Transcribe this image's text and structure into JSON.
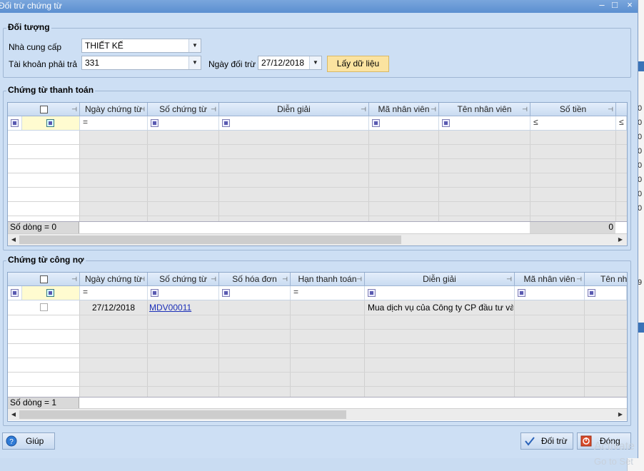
{
  "window": {
    "title": "Đối trừ chứng từ",
    "minimize": "–",
    "maximize": "□",
    "close": "×"
  },
  "doi_tuong": {
    "legend": "Đối tượng",
    "supplier_label": "Nhà cung cấp",
    "supplier_value": "THIẾT KẾ",
    "account_label": "Tài khoản phải trả",
    "account_value": "331",
    "date_label": "Ngày đối trừ",
    "date_value": "27/12/2018",
    "fetch_button": "Lấy dữ liệu"
  },
  "payment_grid": {
    "legend": "Chứng từ thanh toán",
    "columns": [
      "Ngày chứng từ",
      "Số chứng từ",
      "Diễn giải",
      "Mã nhân viên",
      "Tên nhân viên",
      "Số tiền"
    ],
    "filter_ops": {
      "date": "=",
      "amount": "≤",
      "amount2": "≤"
    },
    "row_count_label": "Số dòng = 0",
    "total": "0"
  },
  "debt_grid": {
    "legend": "Chứng từ công nợ",
    "columns": [
      "Ngày chứng từ",
      "Số chứng từ",
      "Số hóa đơn",
      "Hạn thanh toán",
      "Diễn giải",
      "Mã nhân viên",
      "Tên nhâ"
    ],
    "filter_ops": {
      "date": "=",
      "due": "="
    },
    "rows": [
      {
        "date": "27/12/2018",
        "doc_no": "MDV00011",
        "description": "Mua dịch vụ của Công ty CP đầu tư và..."
      }
    ],
    "row_count_label": "Số dòng = 1"
  },
  "buttons": {
    "help": "Giúp",
    "offset": "Đối trừ",
    "close": "Đóng"
  },
  "background_app": {
    "values": [
      "0",
      "0",
      "0",
      "0",
      "0",
      "0",
      "0",
      "0",
      "9",
      "0",
      "0",
      "0",
      "0"
    ]
  },
  "watermark": {
    "line1": "Activate",
    "line2": "Go to Set"
  },
  "colors": {
    "titlebar": "#5b8fd0",
    "window_bg": "#cddff4",
    "fetch_button": "#fbe3a0",
    "link": "#1b2fb8"
  }
}
